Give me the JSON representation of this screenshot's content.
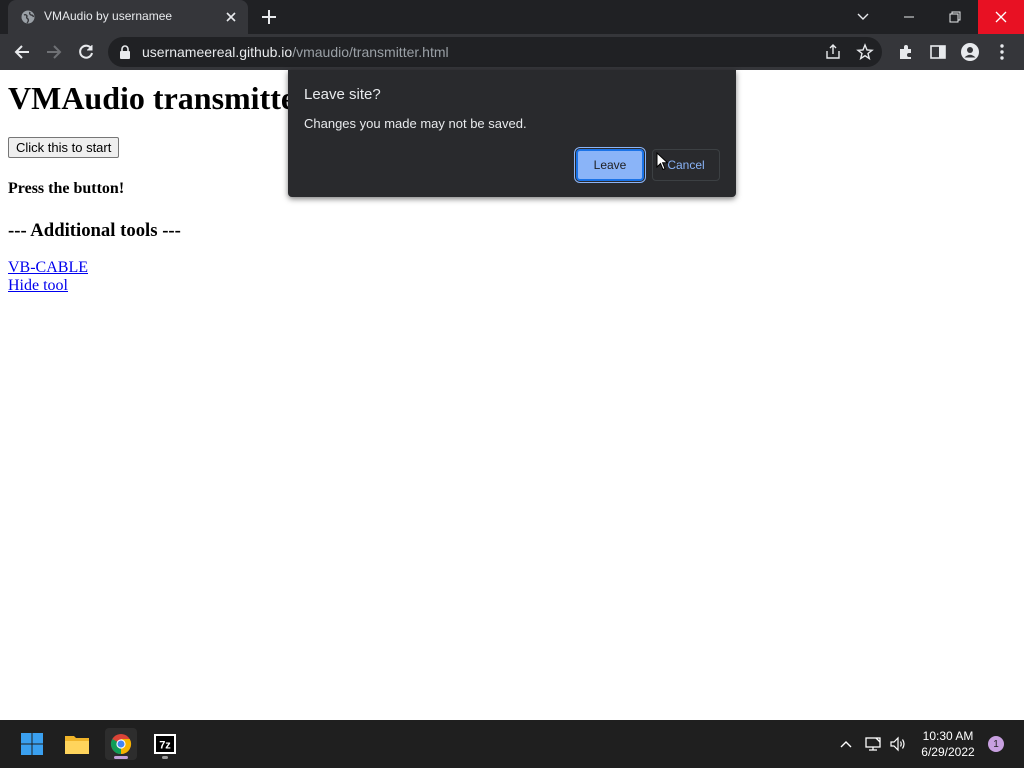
{
  "browser": {
    "tab": {
      "title": "VMAudio by usernamee",
      "favicon": "globe-icon"
    },
    "url": {
      "host": "usernameereal.github.io",
      "path": "/vmaudio/transmitter.html"
    },
    "colors": {
      "chrome_dark": "#202124",
      "chrome_toolbar": "#35363a",
      "close_red": "#e81123",
      "accent_blue": "#8ab4f8"
    }
  },
  "page": {
    "heading": "VMAudio transmitte",
    "start_button": "Click this to start",
    "press_text": "Press the button!",
    "tools_heading": "--- Additional tools ---",
    "links": [
      "VB-CABLE",
      "Hide tool"
    ]
  },
  "dialog": {
    "title": "Leave site?",
    "message": "Changes you made may not be saved.",
    "leave_label": "Leave",
    "cancel_label": "Cancel"
  },
  "taskbar": {
    "apps": [
      "windows-start-icon",
      "file-explorer-icon",
      "chrome-icon",
      "7zip-icon"
    ],
    "time": "10:30 AM",
    "date": "6/29/2022",
    "notification_count": "1"
  }
}
